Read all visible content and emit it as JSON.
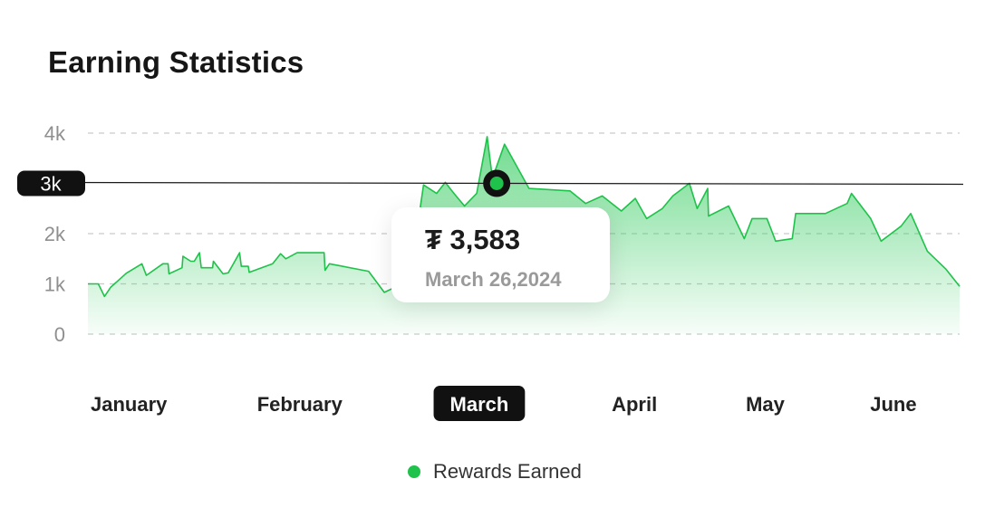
{
  "page": {
    "title": "Earning Statistics"
  },
  "tooltip": {
    "value": "₮ 3,583",
    "date": "March 26,2024"
  },
  "crosshair": {
    "label": "3k",
    "value": 3000
  },
  "legend": {
    "label": "Rewards Earned"
  },
  "colors": {
    "series": "#1fc24a",
    "fill": "#3fcf68",
    "crosshair": "#1a1a1a"
  },
  "chart_data": {
    "type": "area",
    "title": "Earning Statistics",
    "xlabel": "",
    "ylabel": "",
    "ylim": [
      0,
      4000
    ],
    "xlim": [
      0,
      1
    ],
    "grid": true,
    "legend_placement": "bottom",
    "y_ticks": [
      {
        "value": 4000,
        "label": "4k"
      },
      {
        "value": 3000,
        "label": "3k"
      },
      {
        "value": 2000,
        "label": "2k"
      },
      {
        "value": 1000,
        "label": "1k"
      },
      {
        "value": 0,
        "label": "0"
      }
    ],
    "x_ticks": [
      {
        "label": "January",
        "x": 0.047,
        "active": false
      },
      {
        "label": "February",
        "x": 0.243,
        "active": false
      },
      {
        "label": "March",
        "x": 0.449,
        "active": true
      },
      {
        "label": "April",
        "x": 0.627,
        "active": false
      },
      {
        "label": "May",
        "x": 0.777,
        "active": false
      },
      {
        "label": "June",
        "x": 0.924,
        "active": false
      }
    ],
    "highlight": {
      "x": 0.469,
      "y": 3000
    },
    "series": [
      {
        "name": "Rewards Earned",
        "points": [
          [
            0.0,
            1000
          ],
          [
            0.012,
            1000
          ],
          [
            0.019,
            750
          ],
          [
            0.026,
            930
          ],
          [
            0.044,
            1210
          ],
          [
            0.062,
            1400
          ],
          [
            0.067,
            1170
          ],
          [
            0.086,
            1400
          ],
          [
            0.092,
            1400
          ],
          [
            0.093,
            1200
          ],
          [
            0.108,
            1320
          ],
          [
            0.109,
            1550
          ],
          [
            0.118,
            1450
          ],
          [
            0.122,
            1450
          ],
          [
            0.128,
            1620
          ],
          [
            0.13,
            1320
          ],
          [
            0.143,
            1320
          ],
          [
            0.144,
            1450
          ],
          [
            0.155,
            1200
          ],
          [
            0.161,
            1220
          ],
          [
            0.174,
            1620
          ],
          [
            0.176,
            1350
          ],
          [
            0.184,
            1350
          ],
          [
            0.185,
            1230
          ],
          [
            0.212,
            1400
          ],
          [
            0.221,
            1600
          ],
          [
            0.227,
            1500
          ],
          [
            0.24,
            1620
          ],
          [
            0.271,
            1620
          ],
          [
            0.272,
            1270
          ],
          [
            0.277,
            1400
          ],
          [
            0.322,
            1250
          ],
          [
            0.34,
            830
          ],
          [
            0.357,
            970
          ],
          [
            0.375,
            1770
          ],
          [
            0.385,
            2970
          ],
          [
            0.4,
            2800
          ],
          [
            0.41,
            3020
          ],
          [
            0.42,
            2800
          ],
          [
            0.432,
            2550
          ],
          [
            0.446,
            2800
          ],
          [
            0.458,
            3930
          ],
          [
            0.464,
            3100
          ],
          [
            0.478,
            3780
          ],
          [
            0.506,
            2900
          ],
          [
            0.553,
            2850
          ],
          [
            0.571,
            2600
          ],
          [
            0.59,
            2750
          ],
          [
            0.612,
            2450
          ],
          [
            0.628,
            2700
          ],
          [
            0.641,
            2300
          ],
          [
            0.659,
            2500
          ],
          [
            0.671,
            2750
          ],
          [
            0.69,
            3000
          ],
          [
            0.699,
            2500
          ],
          [
            0.711,
            2900
          ],
          [
            0.712,
            2350
          ],
          [
            0.735,
            2550
          ],
          [
            0.753,
            1900
          ],
          [
            0.762,
            2300
          ],
          [
            0.779,
            2300
          ],
          [
            0.789,
            1850
          ],
          [
            0.808,
            1900
          ],
          [
            0.812,
            2400
          ],
          [
            0.846,
            2400
          ],
          [
            0.871,
            2600
          ],
          [
            0.876,
            2800
          ],
          [
            0.898,
            2300
          ],
          [
            0.91,
            1850
          ],
          [
            0.933,
            2150
          ],
          [
            0.944,
            2400
          ],
          [
            0.963,
            1650
          ],
          [
            0.984,
            1300
          ],
          [
            1.0,
            950
          ]
        ]
      }
    ]
  }
}
